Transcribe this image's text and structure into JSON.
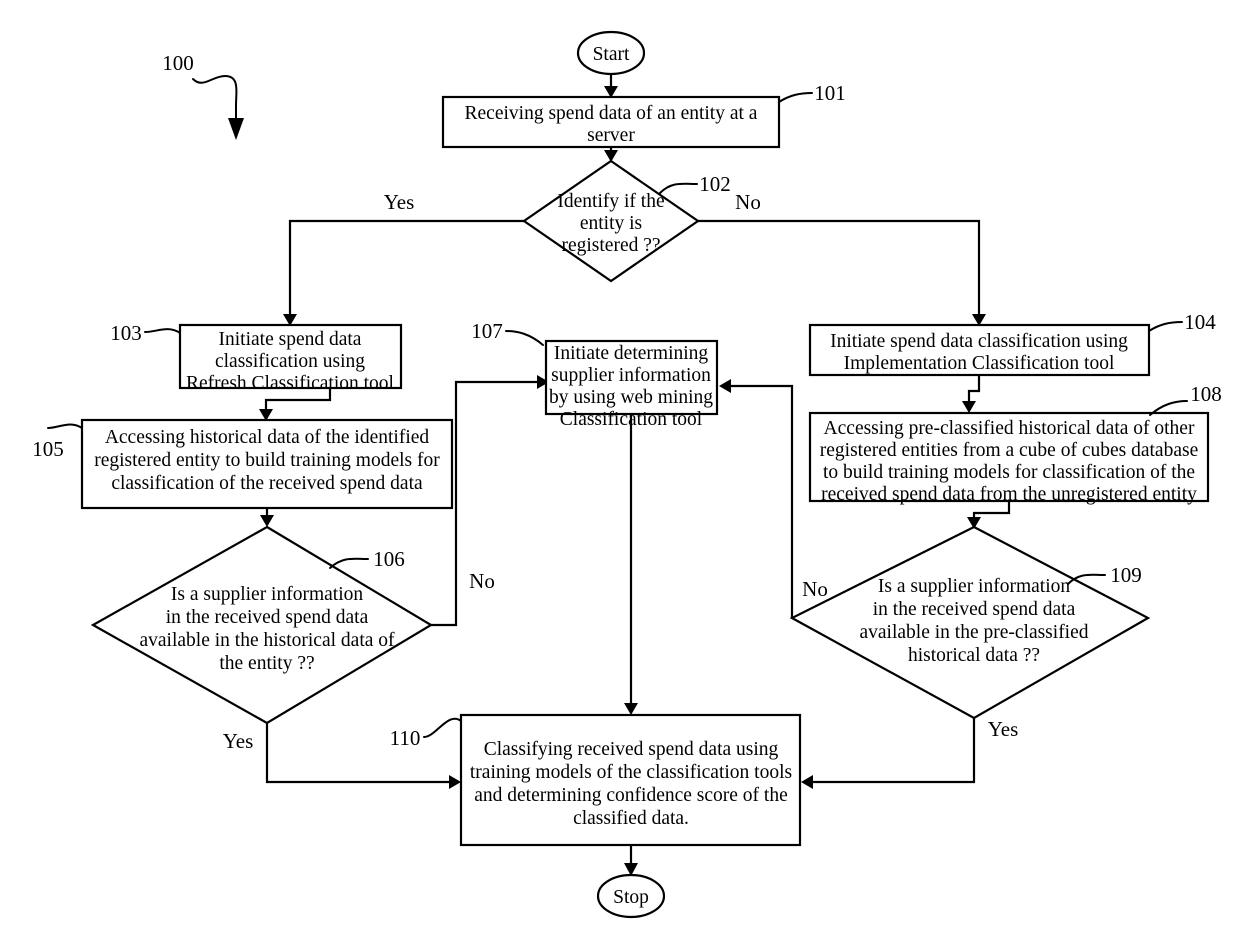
{
  "figure": {
    "figure_ref": "100",
    "type": "patent-flowchart"
  },
  "nodes": {
    "start": {
      "ref": "",
      "label": "Start",
      "shape": "terminator"
    },
    "n101": {
      "ref": "101",
      "shape": "process",
      "lines": [
        "Receiving spend data of an entity at a",
        "server"
      ]
    },
    "n102": {
      "ref": "102",
      "shape": "decision",
      "lines": [
        "Identify if the",
        "entity is",
        "registered ??"
      ]
    },
    "n103": {
      "ref": "103",
      "shape": "process",
      "lines": [
        "Initiate spend data",
        "classification using",
        "Refresh Classification tool"
      ]
    },
    "n104": {
      "ref": "104",
      "shape": "process",
      "lines": [
        "Initiate spend data classification using",
        "Implementation Classification tool"
      ]
    },
    "n105": {
      "ref": "105",
      "shape": "process",
      "lines": [
        "Accessing historical data of the identified",
        "registered entity to build training models for",
        "classification of the received spend data"
      ]
    },
    "n106": {
      "ref": "106",
      "shape": "decision",
      "lines": [
        "Is a supplier information",
        "in the received spend data",
        "available in the historical data of",
        "the entity ??"
      ]
    },
    "n107": {
      "ref": "107",
      "shape": "process",
      "lines": [
        "Initiate determining",
        "supplier information",
        "by using web mining",
        "Classification tool"
      ]
    },
    "n108": {
      "ref": "108",
      "shape": "process",
      "lines": [
        "Accessing pre-classified historical data of other",
        "registered entities from a cube of cubes database",
        "to build training models for classification of the",
        "received spend data from the unregistered entity"
      ]
    },
    "n109": {
      "ref": "109",
      "shape": "decision",
      "lines": [
        "Is a supplier information",
        "in the received spend data",
        "available in the pre-classified",
        "historical data ??"
      ]
    },
    "n110": {
      "ref": "110",
      "shape": "process",
      "lines": [
        "Classifying received spend data using",
        "training models of the classification tools",
        "and determining confidence score of the",
        "classified data."
      ]
    },
    "stop": {
      "ref": "",
      "label": "Stop",
      "shape": "terminator"
    }
  },
  "branch_labels": {
    "b102_yes": "Yes",
    "b102_no": "No",
    "b106_no": "No",
    "b106_yes": "Yes",
    "b109_no": "No",
    "b109_yes": "Yes"
  },
  "colors": {
    "stroke": "#000000",
    "fill": "#ffffff",
    "text": "#000000"
  }
}
